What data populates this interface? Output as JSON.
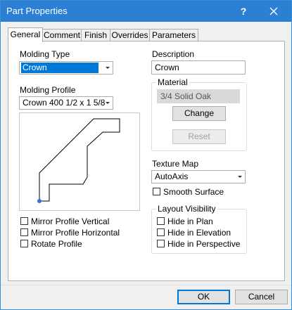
{
  "window": {
    "title": "Part Properties",
    "help": "?"
  },
  "tabs": [
    "General",
    "Comment",
    "Finish",
    "Overrides",
    "Parameters"
  ],
  "general": {
    "molding_type": {
      "label": "Molding Type",
      "value": "Crown"
    },
    "molding_profile": {
      "label": "Molding Profile",
      "value": "Crown 400 1/2 x 1 5/8"
    },
    "description": {
      "label": "Description",
      "value": "Crown"
    },
    "material": {
      "label": "Material",
      "value": "3/4 Solid Oak",
      "change": "Change",
      "reset": "Reset"
    },
    "texture_map": {
      "label": "Texture Map",
      "value": "AutoAxis"
    },
    "smooth_surface": {
      "label": "Smooth Surface",
      "checked": false
    },
    "mirror_vertical": {
      "label": "Mirror Profile Vertical",
      "checked": false
    },
    "mirror_horizontal": {
      "label": "Mirror Profile Horizontal",
      "checked": false
    },
    "rotate_profile": {
      "label": "Rotate Profile",
      "checked": false
    },
    "layout_visibility": {
      "label": "Layout Visibility",
      "hide_in_plan": "Hide in Plan",
      "hide_in_elevation": "Hide in Elevation",
      "hide_in_perspective": "Hide in Perspective"
    }
  },
  "footer": {
    "ok": "OK",
    "cancel": "Cancel"
  },
  "colors": {
    "titlebar": "#2c80d3",
    "selection": "#0078d7",
    "profile_point": "#3a6fd8"
  }
}
